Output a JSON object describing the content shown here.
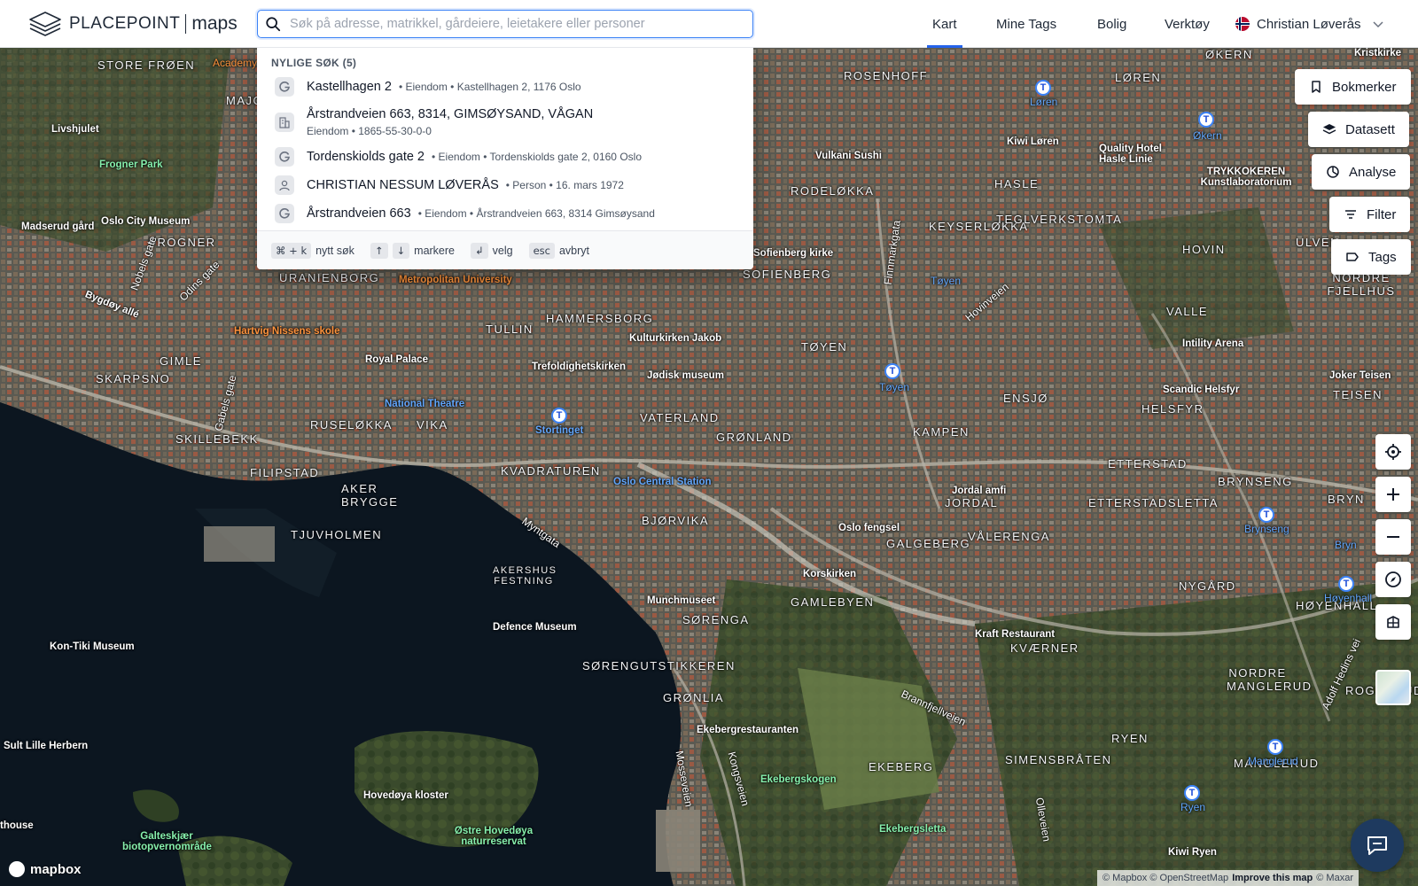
{
  "header": {
    "logo_brand": "PLACEPOINT",
    "logo_product": "maps",
    "search": {
      "placeholder": "Søk på adresse, matrikkel, gårdeiere, leietakere eller personer",
      "value": ""
    },
    "nav": [
      {
        "label": "Kart",
        "active": true
      },
      {
        "label": "Mine Tags",
        "active": false
      },
      {
        "label": "Bolig",
        "active": false
      },
      {
        "label": "Verktøy",
        "active": false
      }
    ],
    "user": {
      "name": "Christian Løverås",
      "flag": "norway-flag"
    }
  },
  "dropdown": {
    "title": "NYLIGE SØK (5)",
    "items": [
      {
        "icon": "google-g-icon",
        "main": "Kastellhagen 2",
        "meta": "• Eiendom • Kastellhagen 2, 1176 Oslo",
        "sub": ""
      },
      {
        "icon": "building-icon",
        "main": "Årstrandveien 663, 8314, GIMSØYSAND, VÅGAN",
        "meta": "",
        "sub": "Eiendom • 1865-55-30-0-0"
      },
      {
        "icon": "google-g-icon",
        "main": "Tordenskiolds gate 2",
        "meta": "• Eiendom • Tordenskiolds gate 2, 0160 Oslo",
        "sub": ""
      },
      {
        "icon": "person-icon",
        "main": "CHRISTIAN NESSUM LØVERÅS",
        "meta": "• Person • 16. mars 1972",
        "sub": ""
      },
      {
        "icon": "google-g-icon",
        "main": "Årstrandveien 663",
        "meta": "• Eiendom • Årstrandveien 663, 8314 Gimsøysand",
        "sub": ""
      }
    ],
    "footer": {
      "new_search_key": "⌘ + k",
      "new_search_label": "nytt søk",
      "mark_keys": [
        "↑",
        "↓"
      ],
      "mark_label": "markere",
      "select_key": "↲",
      "select_label": "velg",
      "cancel_key": "esc",
      "cancel_label": "avbryt"
    }
  },
  "controls": {
    "bookmarks": "Bokmerker",
    "dataset": "Datasett",
    "analysis": "Analyse",
    "filter": "Filter",
    "tags": "Tags"
  },
  "map": {
    "districts": [
      "STORE FRØEN",
      "MAJORSTUA",
      "FROGNER",
      "URANIENBORG",
      "HAMMERSBORG",
      "TULLIN",
      "GIMLE",
      "SKARPSNO",
      "RUSELØKKA",
      "VIKA",
      "SKILLEBEKK",
      "FILIPSTAD",
      "AKER BRYGGE",
      "TJUVHOLMEN",
      "KVADRATUREN",
      "VATERLAND",
      "GRØNLAND",
      "BJØRVIKA",
      "SØRENGA",
      "GAMLEBYEN",
      "GRØNLIA",
      "ROSENHOFF",
      "LØREN",
      "HASLE",
      "KEYSERLØKKA",
      "RODELØKKA",
      "SOFIENBERG",
      "TEGLVERKSTOMTA",
      "HOVIN",
      "ULVEN",
      "TØYEN",
      "ENSJØ",
      "KAMPEN",
      "VALLE",
      "HELSFYR",
      "TEISEN",
      "ETTERSTAD",
      "ETTERSTADSLETTA",
      "JORDAL",
      "VÅLERENGA",
      "GALGEBERG",
      "BRYNSENG",
      "BRYN",
      "NYGÅRD",
      "HØYENHALL",
      "KVÆRNER",
      "NORDRE MANGLERUD",
      "ROGNERUD",
      "EKEBERG",
      "SIMENSBRÅTEN",
      "RYEN",
      "MANGLERUD",
      "NORDRE FJELLHUS",
      "ØKERN",
      "SØRENGUTSTIKKEREN"
    ],
    "pois": [
      "Livshjulet",
      "Frogner Park",
      "Madserud gård",
      "Oslo City Museum",
      "Bygdøy allé",
      "Hartvig Nissens skole",
      "Royal Palace",
      "National Theatre",
      "Stortinget",
      "Trefoldighetskirken",
      "Kulturkirken Jakob",
      "Jødisk museum",
      "Oslo Central Station",
      "Sofienberg kirke",
      "Vulkani Sushi",
      "Kiwi Løren",
      "Quality Hotel Hasle Linie",
      "TRYKKOKEREN Kunstlaboratorium",
      "Intility Arena",
      "Scandic Helsfyr",
      "Joker Teisen",
      "Jordal amfi",
      "Oslo fengsel",
      "Korskirken",
      "Munchmuseet",
      "Defence Museum",
      "Kraft Restaurant",
      "Kon-Tiki Museum",
      "Sult Lille Herbern",
      "Ekebergrestauranten",
      "Ekebergskogen",
      "Ekebergsletta",
      "Hovedøya kloster",
      "Østre Hovedøya naturreservat",
      "Galteskjær biotopvernområde",
      "Kiwi Ryen",
      "Metropolitan University",
      "AKERSHUS FESTNING",
      "Odins gate",
      "Gabels gate",
      "Nobels gate",
      "Finnmarkgata",
      "Hovinveien",
      "Brannfjellveien",
      "Mosseveien",
      "Kongsveien",
      "Olleveien",
      "Adolf Hedins vei",
      "Myntgata",
      "Academy",
      "thouse",
      "Kristkirke"
    ],
    "metro_stations": [
      "Løren",
      "Økern",
      "Tøyen",
      "Tøyen",
      "Stortinget",
      "Brynseng",
      "Bryn",
      "Høyenhall",
      "Manglerud",
      "Ryen"
    ]
  },
  "attribution": {
    "logo": "mapbox",
    "mapbox": "© Mapbox",
    "osm": "© OpenStreetMap",
    "improve": "Improve this map",
    "maxar": "© Maxar"
  },
  "colors": {
    "accent": "#2563eb",
    "focus_border": "#3b82f6",
    "chat": "#1e3a5f"
  }
}
